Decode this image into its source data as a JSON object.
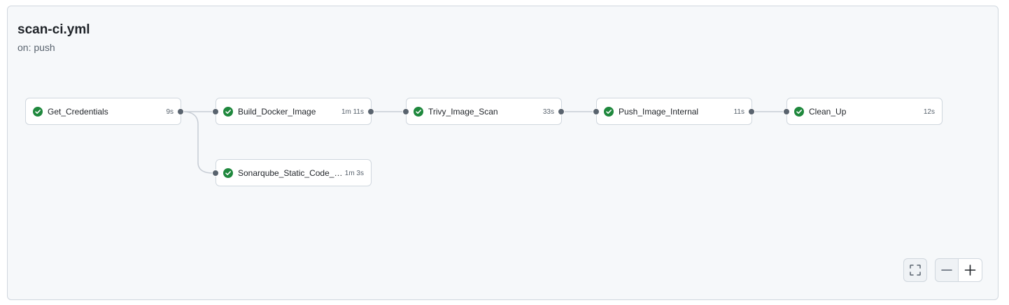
{
  "workflow": {
    "title": "scan-ci.yml",
    "trigger": "on: push"
  },
  "jobs": [
    {
      "name": "Get_Credentials",
      "duration": "9s",
      "status": "success"
    },
    {
      "name": "Build_Docker_Image",
      "duration": "1m 11s",
      "status": "success"
    },
    {
      "name": "Trivy_Image_Scan",
      "duration": "33s",
      "status": "success"
    },
    {
      "name": "Push_Image_Internal",
      "duration": "11s",
      "status": "success"
    },
    {
      "name": "Clean_Up",
      "duration": "12s",
      "status": "success"
    },
    {
      "name": "Sonarqube_Static_Code_A...",
      "duration": "1m 3s",
      "status": "success"
    }
  ],
  "controls": {
    "fullscreen_icon": "fullscreen-icon",
    "zoom_out_icon": "minus-icon",
    "zoom_in_icon": "plus-icon"
  },
  "colors": {
    "success": "#1f883d",
    "edge": "#c6ccd4",
    "port": "#59636e",
    "background": "#f6f8fa"
  }
}
